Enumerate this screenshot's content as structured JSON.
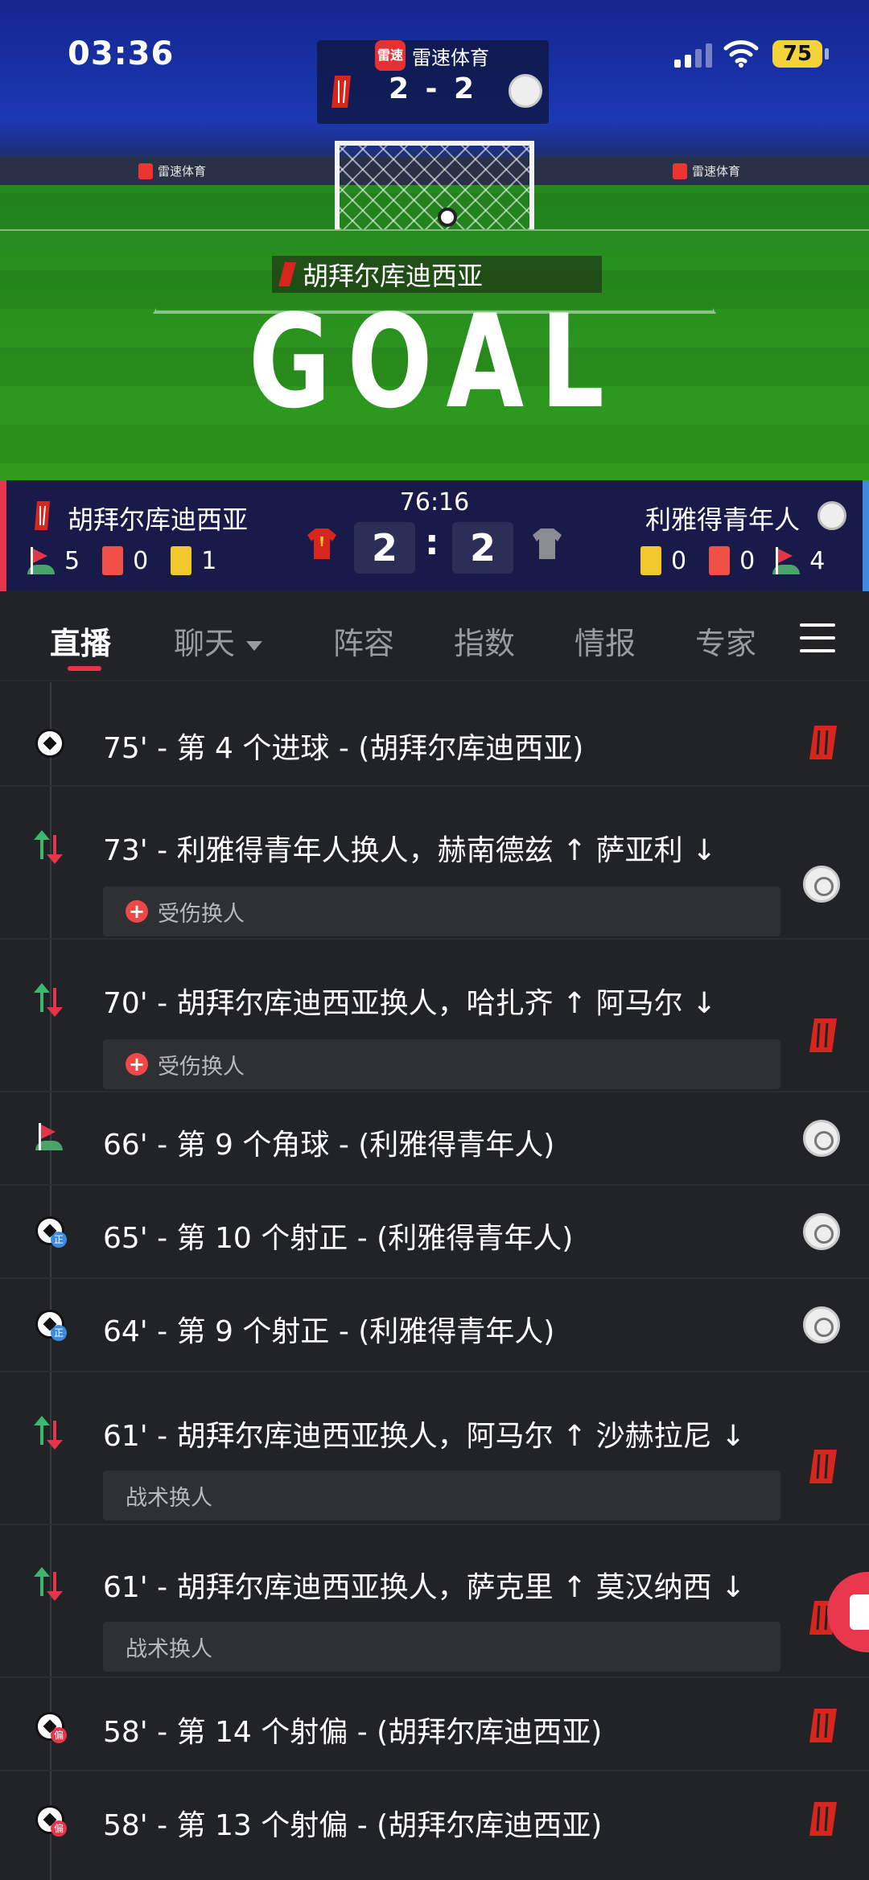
{
  "status_bar": {
    "time": "03:36",
    "battery": "75"
  },
  "broadcast": {
    "brand_logo_text": "雷速",
    "brand_name": "雷速体育",
    "mini_score": "2 - 2",
    "ad_text": "雷速体育",
    "scorer_team": "胡拜尔库迪西亚",
    "goal_text": "GOAL"
  },
  "scoreboard": {
    "clock": "76:16",
    "home": {
      "name": "胡拜尔库迪西亚",
      "corners": "5",
      "red_cards": "0",
      "yellow_cards": "1",
      "score": "2"
    },
    "away": {
      "name": "利雅得青年人",
      "corners": "4",
      "red_cards": "0",
      "yellow_cards": "0",
      "score": "2"
    },
    "separator": ":"
  },
  "tabs": [
    "直播",
    "聊天",
    "阵容",
    "指数",
    "情报",
    "专家"
  ],
  "events": [
    {
      "text": "75' - 第 4 个进球 - (胡拜尔库迪西亚)",
      "icon": "goal-ball-icon",
      "team": "home"
    },
    {
      "text": "73' - 利雅得青年人换人，赫南德兹 ↑ 萨亚利 ↓",
      "icon": "substitution-icon",
      "team": "away",
      "note": "受伤换人",
      "note_injury": true
    },
    {
      "text": "70' - 胡拜尔库迪西亚换人，哈扎齐 ↑ 阿马尔 ↓",
      "icon": "substitution-icon",
      "team": "home",
      "note": "受伤换人",
      "note_injury": true
    },
    {
      "text": "66' - 第 9 个角球 - (利雅得青年人)",
      "icon": "corner-flag-icon",
      "team": "away"
    },
    {
      "text": "65' - 第 10 个射正 - (利雅得青年人)",
      "icon": "shot-on-target-icon",
      "badge": "正",
      "team": "away"
    },
    {
      "text": "64' - 第 9 个射正 - (利雅得青年人)",
      "icon": "shot-on-target-icon",
      "badge": "正",
      "team": "away"
    },
    {
      "text": "61' - 胡拜尔库迪西亚换人，阿马尔 ↑ 沙赫拉尼 ↓",
      "icon": "substitution-icon",
      "team": "home",
      "note": "战术换人",
      "note_injury": false
    },
    {
      "text": "61' - 胡拜尔库迪西亚换人，萨克里 ↑ 莫汉纳西 ↓",
      "icon": "substitution-icon",
      "team": "home",
      "note": "战术换人",
      "note_injury": false
    },
    {
      "text": "58' - 第 14 个射偏 - (胡拜尔库迪西亚)",
      "icon": "shot-off-target-icon",
      "badge": "偏",
      "team": "home"
    },
    {
      "text": "58' - 第 13 个射偏 - (胡拜尔库迪西亚)",
      "icon": "shot-off-target-icon",
      "badge": "偏",
      "team": "home"
    }
  ],
  "colors": {
    "accent": "#e5354a",
    "home": "#d6261e",
    "away_edge": "#3a8ce2",
    "sub_in": "#3bb86d",
    "yellow": "#f3c72e"
  }
}
